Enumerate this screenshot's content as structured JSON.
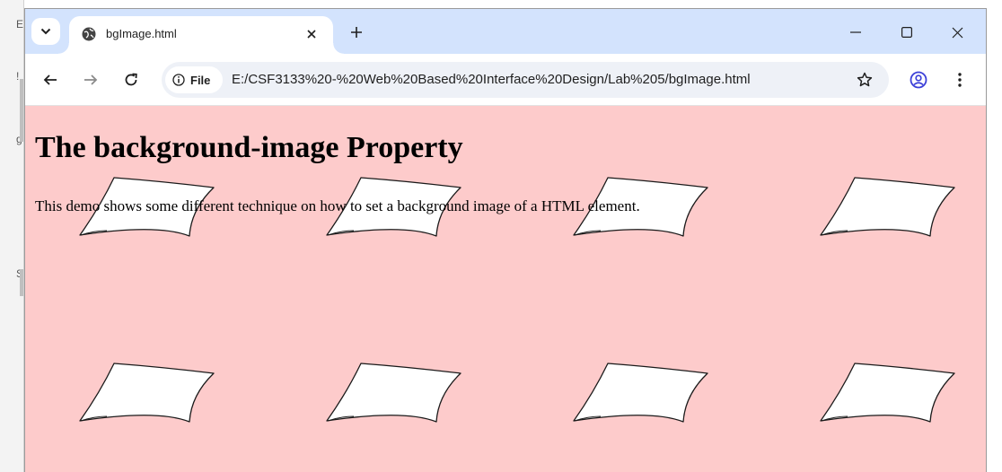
{
  "tab": {
    "title": "bgImage.html"
  },
  "omnibox": {
    "chip_label": "File",
    "url": "E:/CSF3133%20-%20Web%20Based%20Interface%20Design/Lab%205/bgImage.html"
  },
  "page": {
    "heading": "The background-image Property",
    "paragraph": "This demo shows some different technique on how to set a background image of a HTML element.",
    "background_color": "#fdcbcb"
  },
  "icons": {
    "tab_menu": "chevron-down-icon",
    "favicon": "globe-icon",
    "tab_close": "close-icon",
    "new_tab": "plus-icon",
    "minimize": "minimize-icon",
    "maximize": "maximize-icon",
    "close_window": "close-icon",
    "back": "arrow-left-icon",
    "forward": "arrow-right-icon",
    "reload": "reload-icon",
    "site_info": "info-icon",
    "bookmark": "star-icon",
    "profile": "profile-icon",
    "menu": "kebab-menu-icon"
  },
  "behind_window": {
    "fragments": [
      "E",
      "!",
      "g",
      "S"
    ]
  }
}
